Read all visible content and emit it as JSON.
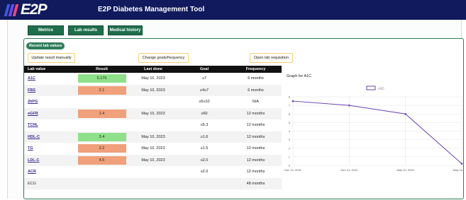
{
  "header": {
    "logo_text": "E2P",
    "app_title": "E2P Diabetes Management Tool",
    "stripe_colors": [
      "#3b5bdb",
      "#7048e8",
      "#e64980"
    ]
  },
  "tabs": [
    {
      "label": "Metrics"
    },
    {
      "label": "Lab results"
    },
    {
      "label": "Medical history"
    }
  ],
  "panel": {
    "title": "Recent lab values",
    "actions": {
      "update": "Update result manually",
      "goals": "Change goals/frequency",
      "requisition": "Open lab requisition"
    }
  },
  "table": {
    "headers": {
      "lab_value": "Lab value",
      "result": "Result",
      "last_done": "Last done",
      "goal": "Goal",
      "frequency": "Frequency"
    },
    "rows": [
      {
        "name": "A1C",
        "result": "5.175",
        "status": "good",
        "last_done": "May 10, 2023",
        "goal": "≤7",
        "frequency": "6 months",
        "link": true
      },
      {
        "name": "FBS",
        "result": "2.1",
        "status": "warn",
        "last_done": "May 10, 2023",
        "goal": "≥4≤7",
        "frequency": "6 months",
        "link": true
      },
      {
        "name": "2hPG",
        "result": "",
        "status": "none",
        "last_done": "",
        "goal": "≥5≤10",
        "frequency": "N/A",
        "link": true
      },
      {
        "name": "eGFR",
        "result": "1.4",
        "status": "warn",
        "last_done": "May 10, 2023",
        "goal": "≥60",
        "frequency": "12 months",
        "link": true
      },
      {
        "name": "TCHL",
        "result": "",
        "status": "none",
        "last_done": "",
        "goal": "≤5.3",
        "frequency": "12 months",
        "link": true
      },
      {
        "name": "HDL-C",
        "result": "3.4",
        "status": "good",
        "last_done": "May 10, 2023",
        "goal": "≥1.6",
        "frequency": "12 months",
        "link": true
      },
      {
        "name": "TG",
        "result": "2.2",
        "status": "warn",
        "last_done": "May 10, 2023",
        "goal": "≤1.5",
        "frequency": "12 months",
        "link": true
      },
      {
        "name": "LDL-C",
        "result": "4.5",
        "status": "warn",
        "last_done": "May 10, 2023",
        "goal": "≤2.0",
        "frequency": "12 months",
        "link": true
      },
      {
        "name": "ACR",
        "result": "",
        "status": "none",
        "last_done": "",
        "goal": "≤2.0",
        "frequency": "12 months",
        "link": true
      },
      {
        "name": "ECG",
        "result": "",
        "status": "none",
        "last_done": "",
        "goal": "",
        "frequency": "48 months",
        "link": false
      }
    ],
    "status_colors": {
      "good": "#8fe08a",
      "warn": "#f0a07a",
      "none": "#ffffff"
    }
  },
  "graph": {
    "title": "Graph for A1C"
  },
  "chart_data": {
    "type": "line",
    "x": [
      "Dec 13, 2021",
      "Dec 13, 2022",
      "May 10, 2023",
      "May 10, 2023"
    ],
    "series": [
      {
        "name": "A1C",
        "values": [
          7.5,
          7.0,
          6.0,
          0.2
        ],
        "color": "#6a3fb5"
      }
    ],
    "yticks": [
      0,
      1,
      2,
      3,
      4,
      5,
      6,
      7,
      8
    ],
    "ylim": [
      0,
      8
    ],
    "grid": true,
    "legend": "top-center"
  }
}
